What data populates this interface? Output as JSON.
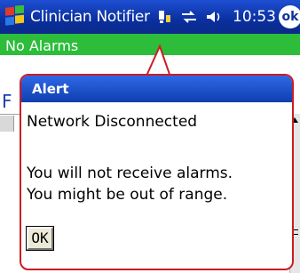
{
  "titlebar": {
    "app_title": "Clinician Notifier",
    "clock": "10:53",
    "ok_label": "ok",
    "icons": [
      "start-flag-icon",
      "connectivity-icon",
      "sync-icon",
      "volume-icon"
    ]
  },
  "status": {
    "text": "No Alarms",
    "color": "#2dbd3a"
  },
  "alert": {
    "title": "Alert",
    "heading": "Network Disconnected",
    "line1": "You will not receive alarms.",
    "line2": "You might be out of range.",
    "ok_button": "OK",
    "border_color": "#cc1d22",
    "title_color": "#1f55d8"
  }
}
